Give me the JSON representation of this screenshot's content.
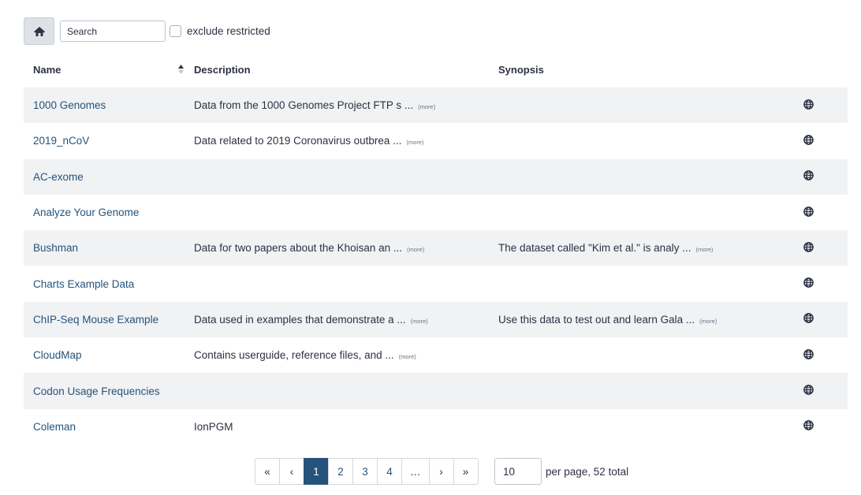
{
  "toolbar": {
    "home_icon": "home-icon",
    "search_placeholder": "Search",
    "exclude_label": "exclude restricted"
  },
  "table": {
    "headers": {
      "name": "Name",
      "description": "Description",
      "synopsis": "Synopsis"
    },
    "more_label": "(more)",
    "rows": [
      {
        "name": "1000 Genomes",
        "description": "Data from the 1000 Genomes Project FTP s ...",
        "synopsis": ""
      },
      {
        "name": "2019_nCoV",
        "description": "Data related to 2019 Coronavirus outbrea ...",
        "synopsis": ""
      },
      {
        "name": "AC-exome",
        "description": "",
        "synopsis": ""
      },
      {
        "name": "Analyze Your Genome",
        "description": "",
        "synopsis": ""
      },
      {
        "name": "Bushman",
        "description": "Data for two papers about the Khoisan an ...",
        "synopsis": "The dataset called \"Kim et al.\" is analy ..."
      },
      {
        "name": "Charts Example Data",
        "description": "",
        "synopsis": ""
      },
      {
        "name": "ChIP-Seq Mouse Example",
        "description": "Data used in examples that demonstrate a ...",
        "synopsis": "Use this data to test out and learn Gala ..."
      },
      {
        "name": "CloudMap",
        "description": "Contains userguide, reference files, and ...",
        "synopsis": ""
      },
      {
        "name": "Codon Usage Frequencies",
        "description": "",
        "synopsis": ""
      },
      {
        "name": "Coleman",
        "description": "IonPGM",
        "synopsis": ""
      }
    ]
  },
  "pagination": {
    "first": "«",
    "prev": "‹",
    "pages": [
      "1",
      "2",
      "3",
      "4"
    ],
    "active_page": "1",
    "ellipsis": "…",
    "next": "›",
    "last": "»",
    "per_page_value": "10",
    "per_page_label": "per page, 52 total"
  }
}
